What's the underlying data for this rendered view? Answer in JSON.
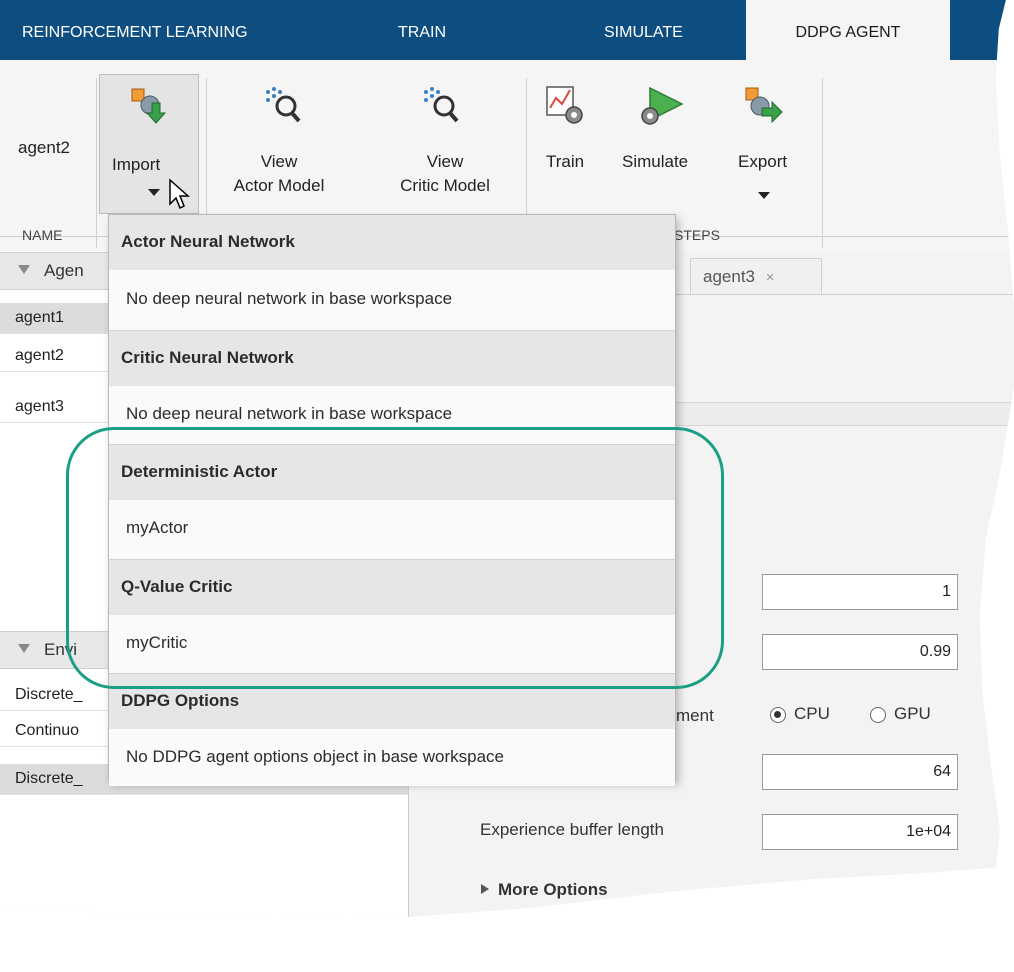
{
  "tabs": [
    {
      "label": "REINFORCEMENT LEARNING"
    },
    {
      "label": "TRAIN"
    },
    {
      "label": "SIMULATE"
    },
    {
      "label": "DDPG AGENT"
    }
  ],
  "ribbon": {
    "name_value": "agent2",
    "import_label": "Import",
    "view_actor_line1": "View",
    "view_actor_line2": "Actor Model",
    "view_critic_line1": "View",
    "view_critic_line2": "Critic Model",
    "train_label": "Train",
    "simulate_label": "Simulate",
    "export_label": "Export",
    "section_name": "NAME",
    "section_steps": "STEPS"
  },
  "left_panel": {
    "agents_header": "Agen",
    "agents": [
      "agent1",
      "agent2",
      "agent3"
    ],
    "envs_header": "Envi",
    "envs": [
      "Discrete_",
      "Continuo",
      "Discrete_"
    ]
  },
  "doc_tabs": [
    {
      "label": "agent3"
    }
  ],
  "form": {
    "field1_value": "1",
    "field2_value": "0.99",
    "device_label_partial": "ment",
    "cpu_label": "CPU",
    "gpu_label": "GPU",
    "minibatch_value": "64",
    "buffer_label": "Experience buffer length",
    "buffer_value": "1e+04",
    "more_options": "More Options"
  },
  "dropdown": {
    "sections": [
      {
        "header": "Actor Neural Network",
        "item": "No deep neural network in base workspace"
      },
      {
        "header": "Critic Neural Network",
        "item": "No deep neural network in base workspace"
      },
      {
        "header": "Deterministic Actor",
        "item": "myActor"
      },
      {
        "header": "Q-Value Critic",
        "item": "myCritic"
      },
      {
        "header": "DDPG Options",
        "item": "No DDPG agent options object in base workspace"
      }
    ]
  },
  "colors": {
    "titlebar": "#0e4d80",
    "highlight": "#1a9e84",
    "export_arrow": "#3aa04a",
    "simulate_play": "#4caf50"
  }
}
